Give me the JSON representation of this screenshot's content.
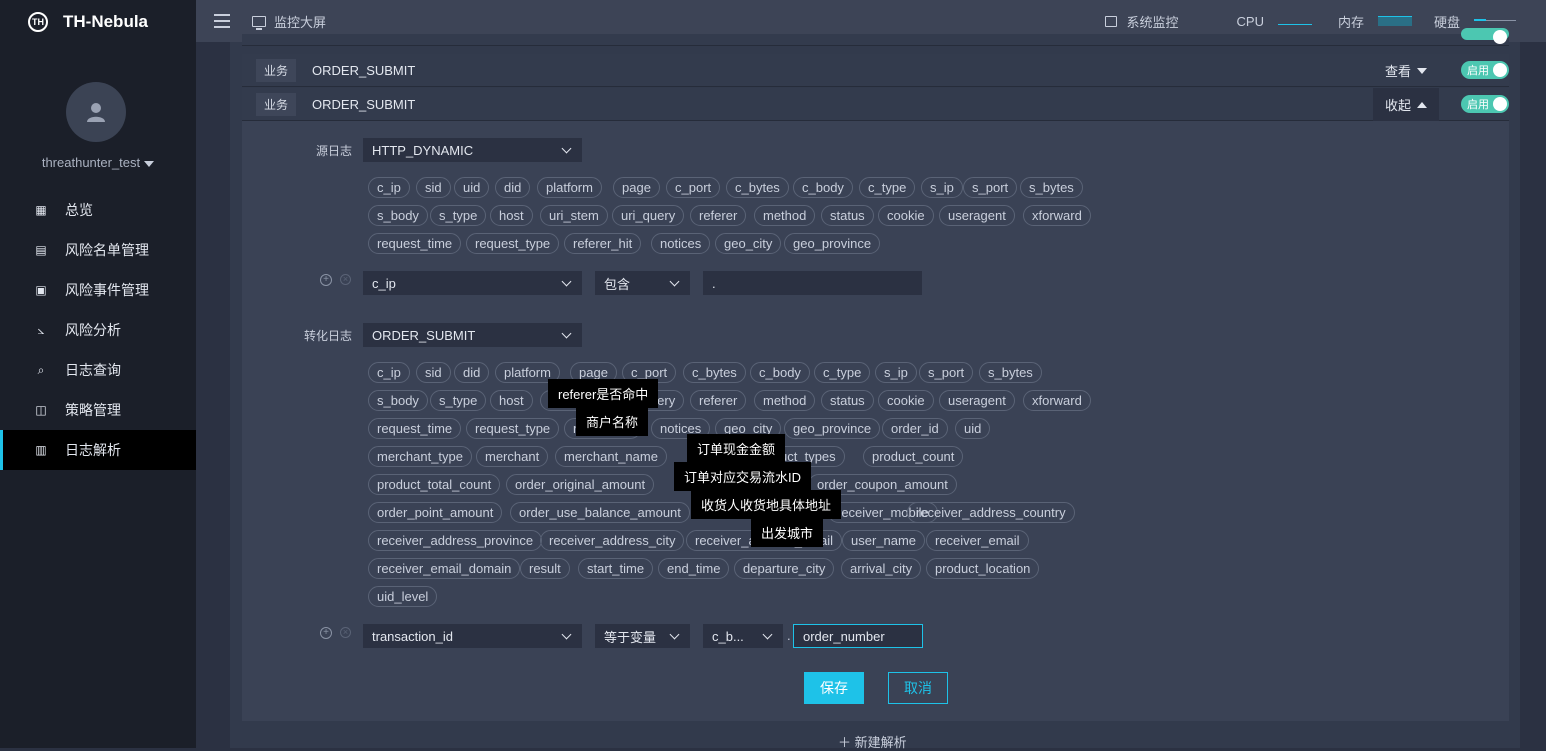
{
  "brand": {
    "name": "TH-Nebula",
    "logo_text": "TH"
  },
  "user": {
    "name": "threathunter_test"
  },
  "nav": [
    {
      "label": "总览",
      "icon": "grid-icon"
    },
    {
      "label": "风险名单管理",
      "icon": "list-icon"
    },
    {
      "label": "风险事件管理",
      "icon": "event-icon"
    },
    {
      "label": "风险分析",
      "icon": "chart-icon"
    },
    {
      "label": "日志查询",
      "icon": "search-icon"
    },
    {
      "label": "策略管理",
      "icon": "strategy-icon"
    },
    {
      "label": "日志解析",
      "icon": "doc-icon",
      "active": true
    }
  ],
  "topbar": {
    "monitor_label": "监控大屏",
    "sysmon_label": "系统监控",
    "cpu_label": "CPU",
    "mem_label": "内存",
    "disk_label": "硬盘"
  },
  "rows": [
    {
      "tag": "业务",
      "name": "ORDER_SUBMIT",
      "action": "查看",
      "toggle": "启用"
    },
    {
      "tag": "业务",
      "name": "ORDER_SUBMIT",
      "action": "收起",
      "toggle": "启用"
    }
  ],
  "source": {
    "label": "源日志",
    "select": "HTTP_DYNAMIC",
    "fields": [
      "c_ip",
      "sid",
      "uid",
      "did",
      "platform",
      "page",
      "c_port",
      "c_bytes",
      "c_body",
      "c_type",
      "s_ip",
      "s_port",
      "s_bytes",
      "s_body",
      "s_type",
      "host",
      "uri_stem",
      "uri_query",
      "referer",
      "method",
      "status",
      "cookie",
      "useragent",
      "xforward",
      "request_time",
      "request_type",
      "referer_hit",
      "notices",
      "geo_city",
      "geo_province"
    ],
    "cond_field": "c_ip",
    "cond_op": "包含",
    "cond_value": "."
  },
  "target": {
    "label": "转化日志",
    "select": "ORDER_SUBMIT",
    "fields": [
      "c_ip",
      "sid",
      "did",
      "platform",
      "page",
      "c_port",
      "c_bytes",
      "c_body",
      "c_type",
      "s_ip",
      "s_port",
      "s_bytes",
      "s_body",
      "s_type",
      "host",
      "uri_stem",
      "uri_query",
      "referer",
      "method",
      "status",
      "cookie",
      "useragent",
      "xforward",
      "request_time",
      "request_type",
      "referer_hit",
      "notices",
      "geo_city",
      "geo_province",
      "order_id",
      "uid",
      "merchant_type",
      "merchant",
      "merchant_name",
      "product_types",
      "product_count",
      "product_total_count",
      "order_original_amount",
      "order_coupon_amount",
      "order_point_amount",
      "order_use_balance_amount",
      "receiver_mobile",
      "receiver_address_country",
      "receiver_address_province",
      "receiver_address_city",
      "receiver_address_detail",
      "user_name",
      "receiver_email",
      "receiver_email_domain",
      "result",
      "start_time",
      "end_time",
      "departure_city",
      "arrival_city",
      "product_location",
      "uid_level"
    ],
    "tooltips": [
      "referer是否命中",
      "商户名称",
      "订单现金金额",
      "订单对应交易流水ID",
      "收货人收货地具体地址",
      "出发城市"
    ],
    "cond_field": "transaction_id",
    "cond_op": "等于变量",
    "cond_var": "c_b...",
    "cond_sep": ".",
    "cond_value": "order_number"
  },
  "buttons": {
    "save": "保存",
    "cancel": "取消",
    "new_parse": "新建解析"
  },
  "colors": {
    "accent": "#1ec2e8",
    "toggle": "#4cc7b1",
    "sidebar": "#1b1f29",
    "topbar": "#3d4456"
  }
}
